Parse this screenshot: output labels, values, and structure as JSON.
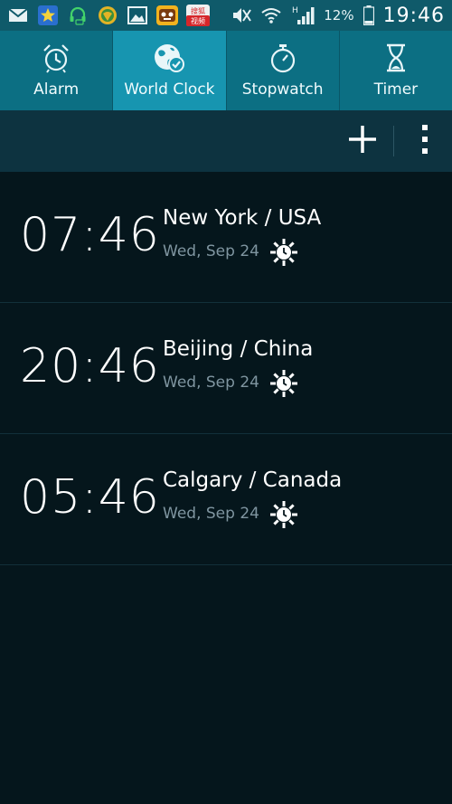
{
  "status_bar": {
    "battery_percent": "12%",
    "time": "19:46",
    "network_type": "H",
    "left_icons": [
      "mail-icon",
      "star-app-icon",
      "headset-icon",
      "globe-app-icon",
      "gallery-icon",
      "game-app-icon",
      "video-app-icon"
    ],
    "video_app_text": "搜狐 视频"
  },
  "tabs": [
    {
      "label": "Alarm",
      "icon": "alarm-clock-icon",
      "active": false
    },
    {
      "label": "World Clock",
      "icon": "globe-check-icon",
      "active": true
    },
    {
      "label": "Stopwatch",
      "icon": "stopwatch-icon",
      "active": false
    },
    {
      "label": "Timer",
      "icon": "hourglass-icon",
      "active": false
    }
  ],
  "action_bar": {
    "add_icon": "plus-icon",
    "menu_icon": "overflow-menu-icon"
  },
  "clocks": [
    {
      "time": "07:46",
      "city": "New York / USA",
      "date": "Wed, Sep 24",
      "icon": "sun-clock-icon"
    },
    {
      "time": "20:46",
      "city": "Beijing / China",
      "date": "Wed, Sep 24",
      "icon": "sun-clock-icon"
    },
    {
      "time": "05:46",
      "city": "Calgary / Canada",
      "date": "Wed, Sep 24",
      "icon": "sun-clock-icon"
    }
  ]
}
